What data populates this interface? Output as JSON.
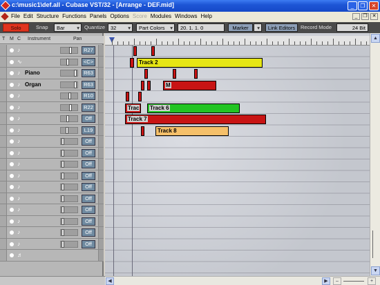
{
  "window": {
    "title": "c:\\music1\\def.all - Cubase VST/32 - [Arrange - DEF.mid]",
    "buttons": [
      "_",
      "❐",
      "✕"
    ]
  },
  "menu": {
    "items": [
      {
        "label": "File",
        "enabled": true
      },
      {
        "label": "Edit",
        "enabled": true
      },
      {
        "label": "Structure",
        "enabled": true
      },
      {
        "label": "Functions",
        "enabled": true
      },
      {
        "label": "Panels",
        "enabled": true
      },
      {
        "label": "Options",
        "enabled": true
      },
      {
        "label": "Score",
        "enabled": false
      },
      {
        "label": "Modules",
        "enabled": true
      },
      {
        "label": "Windows",
        "enabled": true
      },
      {
        "label": "Help",
        "enabled": true
      }
    ],
    "mdi_buttons": [
      "_",
      "❐",
      "✕"
    ]
  },
  "toolbar": {
    "solo": "Solo",
    "snap_label": "Snap",
    "snap_value": "Bar",
    "quantize_label": "Quantize",
    "quantize_value": "32",
    "part_colors": "Part Colors",
    "position": "20. 1. 1.     0",
    "marker": "Marker",
    "link_editors": "Link Editors",
    "record_mode_label": "Record Mode",
    "record_mode_value": "24 Bit"
  },
  "tracklist": {
    "headers": {
      "t": "T",
      "m": "M",
      "c": "C",
      "instrument": "Instrument",
      "pan": "Pan"
    },
    "tracks": [
      {
        "ctype": "♪",
        "name": "",
        "pan": "R27",
        "fader": 0.62
      },
      {
        "ctype": "∿",
        "name": "",
        "pan": "<C>",
        "fader": 0.38
      },
      {
        "ctype": "♪",
        "name": "Piano",
        "pan": "R63",
        "fader": 0.95
      },
      {
        "ctype": "♪",
        "name": "Organ",
        "pan": "R63",
        "fader": 0.95
      },
      {
        "ctype": "♪",
        "name": "",
        "pan": "R10",
        "fader": 0.55
      },
      {
        "ctype": "♪",
        "name": "",
        "pan": "R22",
        "fader": 0.6
      },
      {
        "ctype": "♪",
        "name": "",
        "pan": "Off",
        "fader": 0.42
      },
      {
        "ctype": "♪",
        "name": "",
        "pan": "L19",
        "fader": 0.35
      },
      {
        "ctype": "♪",
        "name": "",
        "pan": "Off",
        "fader": 0.05
      },
      {
        "ctype": "♪",
        "name": "",
        "pan": "Off",
        "fader": 0.05
      },
      {
        "ctype": "♪",
        "name": "",
        "pan": "Off",
        "fader": 0.05
      },
      {
        "ctype": "♪",
        "name": "",
        "pan": "Off",
        "fader": 0.05
      },
      {
        "ctype": "♪",
        "name": "",
        "pan": "Off",
        "fader": 0.05
      },
      {
        "ctype": "♪",
        "name": "",
        "pan": "Off",
        "fader": 0.05
      },
      {
        "ctype": "♪",
        "name": "",
        "pan": "Off",
        "fader": 0.05
      },
      {
        "ctype": "♪",
        "name": "",
        "pan": "Off",
        "fader": 0.05
      },
      {
        "ctype": "♪",
        "name": "",
        "pan": "Off",
        "fader": 0.05
      },
      {
        "ctype": "♪",
        "name": "",
        "pan": "Off",
        "fader": 0.05
      },
      {
        "ctype": "♬",
        "name": "",
        "pan": "",
        "fader": null
      }
    ]
  },
  "arrange": {
    "parts": [
      {
        "track": 0,
        "label": "",
        "color": "red"
      },
      {
        "track": 0,
        "label": "",
        "color": "red"
      },
      {
        "track": 1,
        "label": "",
        "color": "red"
      },
      {
        "track": 1,
        "label": "Track 2",
        "color": "yellow"
      },
      {
        "track": 2,
        "label": "",
        "color": "red"
      },
      {
        "track": 2,
        "label": "",
        "color": "red"
      },
      {
        "track": 2,
        "label": "",
        "color": "red"
      },
      {
        "track": 3,
        "label": "",
        "color": "red"
      },
      {
        "track": 3,
        "label": "",
        "color": "red"
      },
      {
        "track": 3,
        "label": "M",
        "color": "red"
      },
      {
        "track": 4,
        "label": "",
        "color": "red"
      },
      {
        "track": 4,
        "label": "",
        "color": "red"
      },
      {
        "track": 5,
        "label": "Trac",
        "color": "red"
      },
      {
        "track": 5,
        "label": "Track 6",
        "color": "green"
      },
      {
        "track": 6,
        "label": "Track 7",
        "color": "red"
      },
      {
        "track": 7,
        "label": "",
        "color": "red"
      },
      {
        "track": 7,
        "label": "Track 8",
        "color": "orange"
      }
    ]
  },
  "colors": {
    "red": "#c81414",
    "yellow": "#e6e615",
    "green": "#22c422",
    "orange": "#f5c06a",
    "titlebar": "#1e56d6",
    "solo": "#e0341e"
  }
}
